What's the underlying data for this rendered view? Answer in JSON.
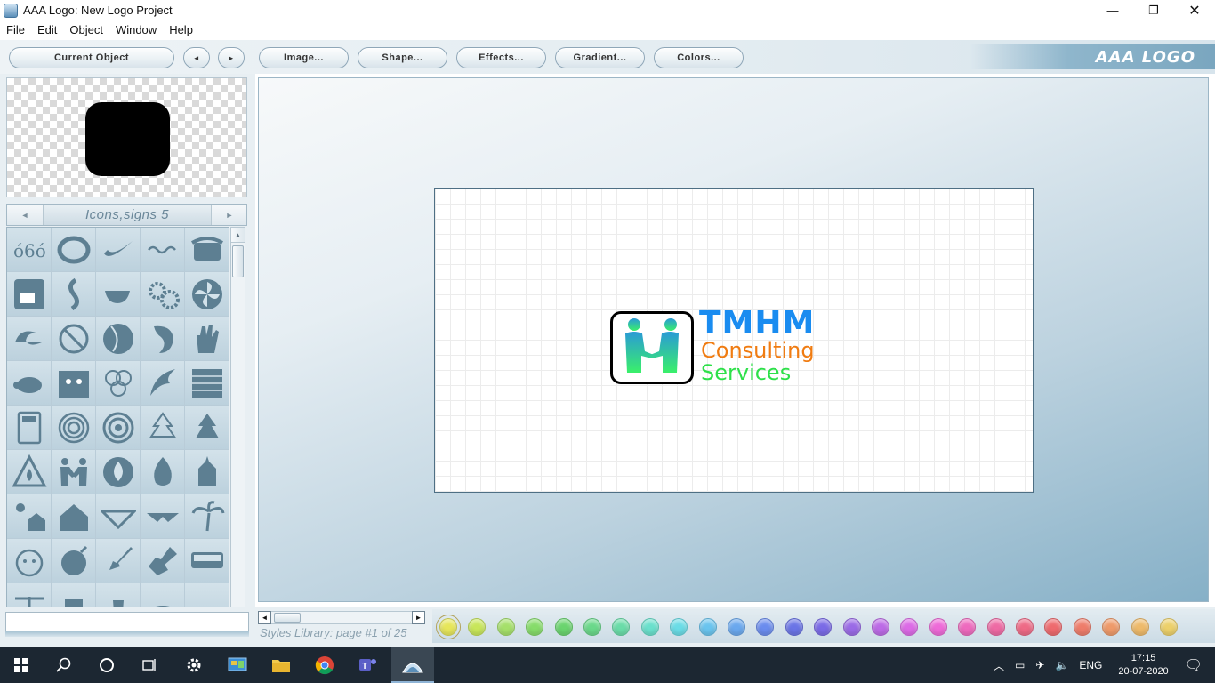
{
  "window": {
    "title": "AAA Logo: New Logo Project",
    "minimize": "—",
    "restore": "❐",
    "close": "✕"
  },
  "menu": [
    "File",
    "Edit",
    "Object",
    "Window",
    "Help"
  ],
  "toolbar": {
    "current_object": "Current Object",
    "prev": "◄",
    "next": "►",
    "image": "Image...",
    "shape": "Shape...",
    "effects": "Effects...",
    "gradient": "Gradient...",
    "colors": "Colors...",
    "brand": "AAA LOGO"
  },
  "icon_library": {
    "title": "Icons,signs 5",
    "prev": "◄",
    "next": "►",
    "icons": [
      "flame-trio-icon",
      "ring-icon",
      "swoosh-icon",
      "wave-icon",
      "telephone-icon",
      "coffee-mug-icon",
      "s-curve-icon",
      "teacup-icon",
      "gears-icon",
      "fan-icon",
      "swirl-wave-icon",
      "no-smoking-icon",
      "moon-icon",
      "globe-icon",
      "hand-print-icon",
      "turtle-icon",
      "family-icon",
      "flower-icon",
      "phoenix-icon",
      "brick-wall-icon",
      "calculator-icon",
      "spiral-icon",
      "spiral-2-icon",
      "xmas-tree-outline-icon",
      "xmas-tree-icon",
      "warning-fire-icon",
      "handshake-icon",
      "fire-circle-icon",
      "flame-icon",
      "church-icon",
      "sun-house-icon",
      "house-icon",
      "wings-emblem-icon",
      "wings-emblem-2-icon",
      "palm-tree-icon",
      "face-icon",
      "bomb-icon",
      "paint-brush-icon",
      "stamp-icon",
      "bus-icon",
      "windmill-icon",
      "cup-icon",
      "vase-icon",
      "oval-icon",
      "blank-icon"
    ]
  },
  "scrollbar": {
    "up": "▲",
    "down": "▼",
    "left": "◄",
    "right": "►"
  },
  "logo": {
    "title": "TMHM",
    "line1": "Consulting",
    "line2": "Services",
    "colors": {
      "title": "#1a8cf0",
      "line1": "#f07c12",
      "line2": "#2ee04a"
    }
  },
  "styles_library": {
    "label": "Styles Library: page #1 of 25"
  },
  "swatches": [
    "#e6e65a",
    "#c8e65a",
    "#a5e06a",
    "#86dc6a",
    "#6ad46e",
    "#6ad88a",
    "#6adca8",
    "#6ae0cc",
    "#6adce6",
    "#6ac4ee",
    "#6aa8ee",
    "#6a8cee",
    "#6a74e6",
    "#7a6ae6",
    "#9a6ae6",
    "#bc6ae6",
    "#dc6ae6",
    "#ee6ad8",
    "#ee6abe",
    "#ee6aa4",
    "#ee6a86",
    "#ee6a6e",
    "#ee7c6a",
    "#ee9a6a",
    "#eeba6a",
    "#ecd06a"
  ],
  "selected_swatch_index": 0,
  "taskbar": {
    "language": "ENG",
    "time": "17:15",
    "date": "20-07-2020"
  }
}
